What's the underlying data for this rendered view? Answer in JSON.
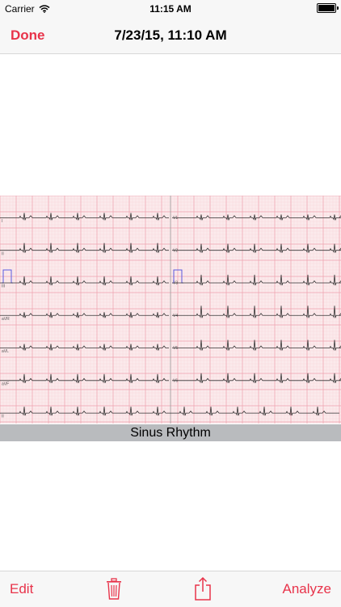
{
  "status": {
    "carrier": "Carrier",
    "time": "11:15 AM"
  },
  "nav": {
    "done_label": "Done",
    "title": "7/23/15, 11:10 AM"
  },
  "ecg": {
    "left_leads": [
      "I",
      "II",
      "III",
      "aVR",
      "aVL",
      "aVF",
      "II"
    ],
    "right_leads": [
      "V1",
      "V2",
      "V3",
      "V4",
      "V5",
      "V6"
    ],
    "grid_color": "#f2b9c2",
    "trace_color": "#333333",
    "calibration_color": "#5a5adf"
  },
  "rhythm": {
    "label": "Sinus Rhythm"
  },
  "toolbar": {
    "edit_label": "Edit",
    "analyze_label": "Analyze",
    "trash_icon": "trash-icon",
    "share_icon": "share-icon"
  },
  "colors": {
    "accent": "#e8334a"
  }
}
